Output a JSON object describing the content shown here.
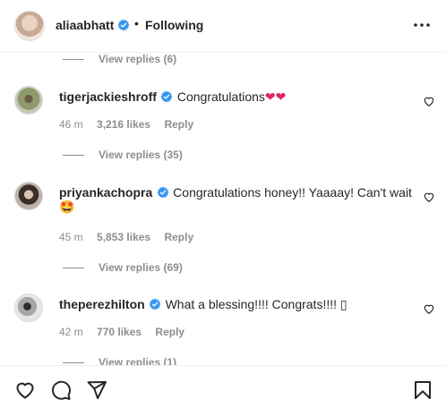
{
  "header": {
    "username": "aliaabhatt",
    "separator": "•",
    "follow_status": "Following",
    "more_icon": "more-horizontal-icon"
  },
  "comments": [
    {
      "view_replies_label": "View replies (6)"
    },
    {
      "username": "tigerjackieshroff",
      "text": "Congratulations",
      "emoji": "❤❤",
      "time": "46 m",
      "likes": "3,216 likes",
      "reply": "Reply",
      "view_replies_label": "View replies (35)"
    },
    {
      "username": "priyankachopra",
      "text": "Congratulations honey!! Yaaaay! Can't wait",
      "emoji": "🤩",
      "time": "45 m",
      "likes": "5,853 likes",
      "reply": "Reply",
      "view_replies_label": "View replies (69)"
    },
    {
      "username": "theperezhilton",
      "text": "What a blessing!!!! Congrats!!!! ▯",
      "time": "42 m",
      "likes": "770 likes",
      "reply": "Reply",
      "view_replies_label": "View replies (1)"
    }
  ],
  "colors": {
    "verified": "#3897f0",
    "heart_red": "#ed4956",
    "muted": "#8e8e8e",
    "text": "#262626"
  },
  "bottom_bar": {
    "icons": [
      "heart-icon",
      "comment-icon",
      "share-icon",
      "bookmark-icon"
    ]
  }
}
